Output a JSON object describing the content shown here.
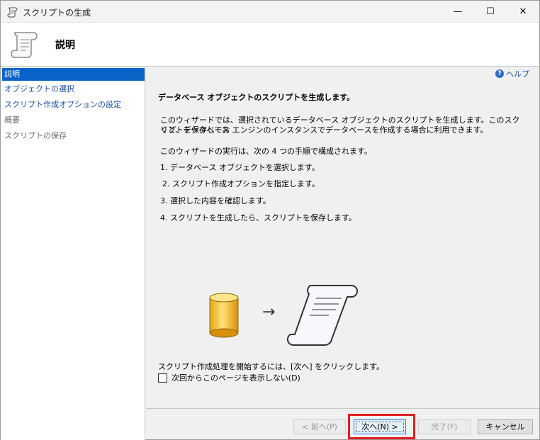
{
  "window": {
    "title": "スクリプトの生成",
    "controls": {
      "minimize": "—",
      "maximize": "☐",
      "close": "✕"
    }
  },
  "header": {
    "title": "説明"
  },
  "nav": {
    "items": [
      {
        "label": "説明",
        "state": "selected"
      },
      {
        "label": "オブジェクトの選択",
        "state": "link"
      },
      {
        "label": "スクリプト作成オプションの設定",
        "state": "link"
      },
      {
        "label": "概要",
        "state": "disabled"
      },
      {
        "label": "スクリプトの保存",
        "state": "disabled"
      }
    ]
  },
  "content": {
    "help_label": "ヘルプ",
    "heading": "データベース オブジェクトのスクリプトを生成します。",
    "intro_line1": "このウィザードでは、選択されているデータベース オブジェクトのスクリプトを生成します。このスクリプトを保存してお",
    "intro_line2": "くと、データベース エンジンのインスタンスでデータベースを作成する場合に利用できます。",
    "steps_intro": "このウィザードの実行は、次の 4 つの手順で構成されます。",
    "steps": [
      "1. データベース オブジェクトを選択します。",
      "2. スクリプト作成オプションを指定します。",
      "3. 選択した内容を確認します。",
      "4. スクリプトを生成したら、スクリプトを保存します。"
    ],
    "start_text": "スクリプト作成処理を開始するには、[次へ] をクリックします。",
    "checkbox_label": "次回からこのページを表示しない(D)",
    "arrow_glyph": "→"
  },
  "footer": {
    "back": "< 前へ(P)",
    "next": "次へ(N) >",
    "finish": "完了(F)",
    "cancel": "キャンセル"
  },
  "colors": {
    "selection": "#0a64c8",
    "link": "#1a4fa0",
    "highlight_box": "#e01e1e"
  }
}
